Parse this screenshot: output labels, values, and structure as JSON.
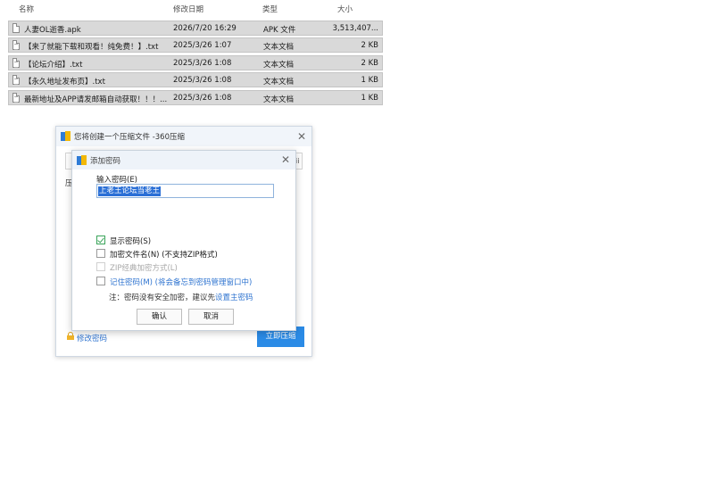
{
  "file_list": {
    "headers": {
      "name": "名称",
      "date": "修改日期",
      "type": "类型",
      "size": "大小"
    },
    "rows": [
      {
        "name": "人妻OL逝香.apk",
        "date": "2026/7/20 16:29",
        "type": "APK 文件",
        "size": "3,513,407...",
        "icon": "file-icon"
      },
      {
        "name": "【来了就能下载和观看！纯免费！】.txt",
        "date": "2025/3/26 1:07",
        "type": "文本文档",
        "size": "2 KB",
        "icon": "text-file-icon"
      },
      {
        "name": "【论坛介绍】.txt",
        "date": "2025/3/26 1:08",
        "type": "文本文档",
        "size": "2 KB",
        "icon": "text-file-icon"
      },
      {
        "name": "【永久地址发布页】.txt",
        "date": "2025/3/26 1:08",
        "type": "文本文档",
        "size": "1 KB",
        "icon": "text-file-icon"
      },
      {
        "name": "最新地址及APP请发邮箱自动获取！！！...",
        "date": "2025/3/26 1:08",
        "type": "文本文档",
        "size": "1 KB",
        "icon": "text-file-icon"
      }
    ]
  },
  "outer_dialog": {
    "title": "您将创建一个压缩文件 -360压缩",
    "side_label": "压",
    "stub_glyph": "ii",
    "modify_password": "修改密码",
    "compress_now": "立即压缩"
  },
  "password_dialog": {
    "title": "添加密码",
    "input_label": "输入密码(E)",
    "input_value": "上老王论坛当老王",
    "options": {
      "show_password": "显示密码(S)",
      "encrypt_filenames": "加密文件名(N) (不支持ZIP格式)",
      "zip_classic": "ZIP经典加密方式(L)",
      "remember_password": "记住密码(M) (将会备忘到密码管理窗口中)"
    },
    "note_prefix": "注：密码没有安全加密，建议先",
    "note_link": "设置主密码",
    "ok_label": "确认",
    "cancel_label": "取消"
  },
  "colors": {
    "accent": "#2b8be6",
    "link": "#2f74d0",
    "row_selected": "#d9d9d9",
    "check_green": "#3aa45a"
  }
}
